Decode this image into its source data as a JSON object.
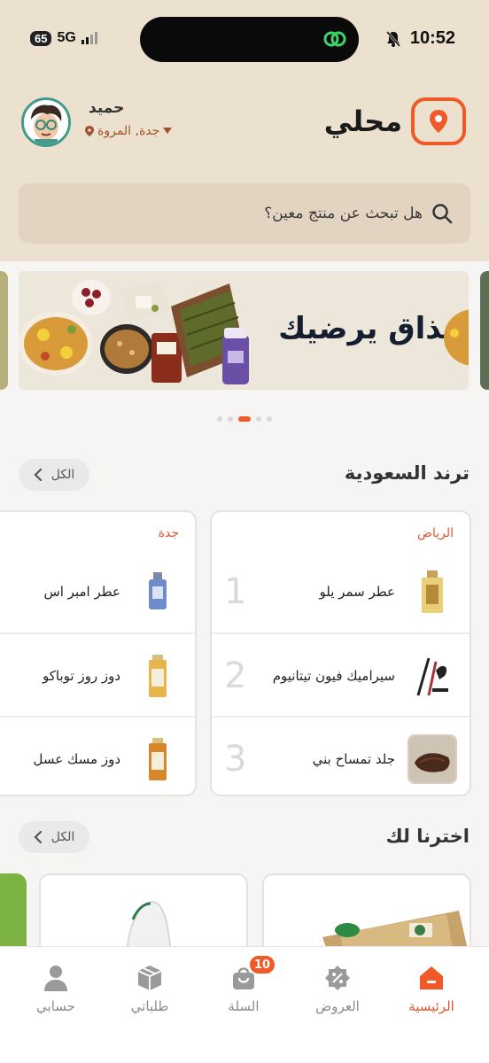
{
  "status_bar": {
    "battery": "65",
    "network": "5G",
    "time": "10:52"
  },
  "header": {
    "logo_text": "محلي",
    "user_name": "حميد",
    "location": "جدة, المروة"
  },
  "search": {
    "placeholder": "هل تبحث عن منتج معين؟"
  },
  "banner": {
    "title": "مذاق يرضيك",
    "slide_count": 5,
    "active_slide": 3
  },
  "trending": {
    "title": "ترند السعودية",
    "all_label": "الكل",
    "cards": [
      {
        "city": "الرياض",
        "items": [
          {
            "rank": "1",
            "name": "عطر سمر يلو"
          },
          {
            "rank": "2",
            "name": "سيراميك فيون تيتانيوم"
          },
          {
            "rank": "3",
            "name": "جلد تمساح بني"
          }
        ]
      },
      {
        "city": "جدة",
        "items": [
          {
            "name": "عطر امبر اس"
          },
          {
            "name": "دوز روز توباكو"
          },
          {
            "name": "دوز مسك عسل"
          }
        ]
      }
    ]
  },
  "picks": {
    "title": "اخترنا لك",
    "all_label": "الكل"
  },
  "bottom_nav": {
    "home": "الرئيسية",
    "offers": "العروض",
    "cart": "السلة",
    "cart_count": "10",
    "orders": "طلباتي",
    "account": "حسابي"
  },
  "colors": {
    "accent": "#f05a28",
    "header_bg": "#ece0ce",
    "search_bg": "#e2d4c0"
  }
}
